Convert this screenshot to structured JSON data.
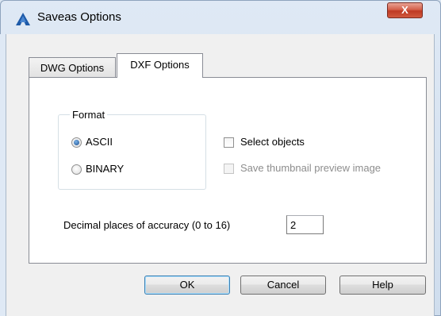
{
  "window": {
    "title": "Saveas Options",
    "close_label": "X"
  },
  "tabs": [
    {
      "label": "DWG Options",
      "selected": false
    },
    {
      "label": "DXF Options",
      "selected": true
    }
  ],
  "format": {
    "legend": "Format",
    "options": [
      {
        "label": "ASCII",
        "checked": true
      },
      {
        "label": "BINARY",
        "checked": false
      }
    ]
  },
  "checkboxes": {
    "select_objects": {
      "label": "Select objects",
      "checked": false,
      "enabled": true
    },
    "save_thumbnail": {
      "label": "Save thumbnail preview image",
      "checked": false,
      "enabled": false
    }
  },
  "decimal": {
    "label": "Decimal places of accuracy (0 to 16)",
    "value": "2"
  },
  "buttons": {
    "ok": "OK",
    "cancel": "Cancel",
    "help": "Help"
  },
  "icons": {
    "app": "autocad-app-icon",
    "close": "close-icon"
  },
  "colors": {
    "accent": "#1e5aa8",
    "close_button": "#c9472f"
  }
}
